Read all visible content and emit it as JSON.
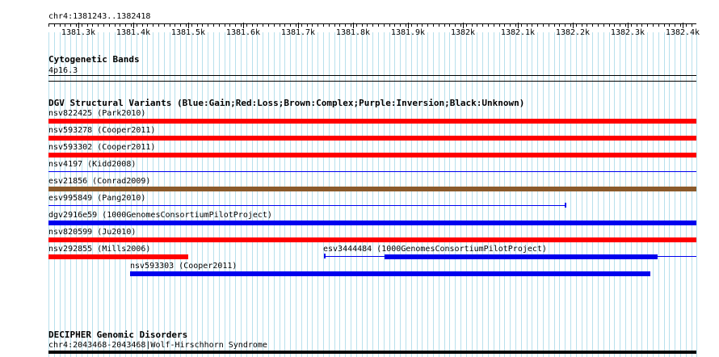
{
  "position": {
    "label": "chr4:1381243..1382418"
  },
  "ruler": {
    "ticks": [
      "1381.3k",
      "1381.4k",
      "1381.5k",
      "1381.6k",
      "1381.7k",
      "1381.8k",
      "1381.9k",
      "1382k",
      "1382.1k",
      "1382.2k",
      "1382.3k",
      "1382.4k"
    ]
  },
  "tracks": {
    "cytoband": {
      "title": "Cytogenetic Bands",
      "band": "4p16.3"
    },
    "dgv": {
      "title": "DGV Structural Variants (Blue:Gain;Red:Loss;Brown:Complex;Purple:Inversion;Black:Unknown)",
      "features": [
        {
          "label": "nsv822425 (Park2010)"
        },
        {
          "label": "nsv593278 (Cooper2011)"
        },
        {
          "label": "nsv593302 (Cooper2011)"
        },
        {
          "label": "nsv4197 (Kidd2008)"
        },
        {
          "label": "esv21856 (Conrad2009)"
        },
        {
          "label": "esv995849 (Pang2010)"
        },
        {
          "label": "dgv2916e59 (1000GenomesConsortiumPilotProject)"
        },
        {
          "label": "nsv820599 (Ju2010)"
        },
        {
          "label": "nsv292855 (Mills2006)"
        },
        {
          "label": "esv3444484 (1000GenomesConsortiumPilotProject)"
        },
        {
          "label": "nsv593303 (Cooper2011)"
        }
      ]
    },
    "decipher": {
      "title": "DECIPHER Genomic Disorders",
      "feature": "chr4:2043468-2043468|Wolf-Hirschhorn Syndrome"
    }
  },
  "colors": {
    "loss": "#ff0000",
    "gain": "#0000ee",
    "complex": "#8b5a2b",
    "grid": "#b8e0ec"
  }
}
